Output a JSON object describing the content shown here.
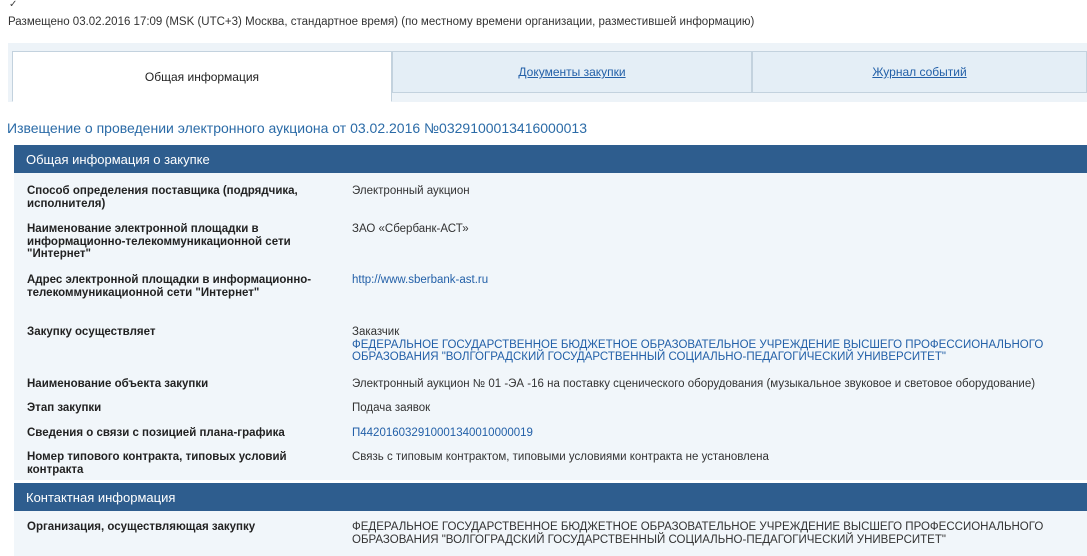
{
  "top_mark": "✓",
  "posted_line": "Размещено 03.02.2016 17:09 (MSK (UTC+3) Москва, стандартное время) (по местному времени организации, разместившей информацию)",
  "tabs": [
    {
      "label": "Общая информация",
      "active": true
    },
    {
      "label": "Документы закупки",
      "active": false
    },
    {
      "label": "Журнал событий",
      "active": false
    }
  ],
  "notice_title": "Извещение о проведении электронного аукциона от 03.02.2016 №0329100013416000013",
  "general": {
    "heading": "Общая информация о закупке",
    "rows": [
      {
        "label": "Способ определения поставщика (подрядчика, исполнителя)",
        "value": "Электронный аукцион"
      },
      {
        "label": "Наименование электронной площадки в информационно-телекоммуникационной сети \"Интернет\"",
        "value": "ЗАО «Сбербанк-АСТ»"
      },
      {
        "label": "Адрес электронной площадки в информационно-телекоммуникационной сети \"Интернет\"",
        "value": "http://www.sberbank-ast.ru"
      },
      {
        "label": "Закупку осуществляет",
        "value_role": "Заказчик",
        "value": "ФЕДЕРАЛЬНОЕ ГОСУДАРСТВЕННОЕ БЮДЖЕТНОЕ ОБРАЗОВАТЕЛЬНОЕ УЧРЕЖДЕНИЕ ВЫСШЕГО ПРОФЕССИОНАЛЬНОГО ОБРАЗОВАНИЯ \"ВОЛГОГРАДСКИЙ ГОСУДАРСТВЕННЫЙ СОЦИАЛЬНО-ПЕДАГОГИЧЕСКИЙ УНИВЕРСИТЕТ\""
      },
      {
        "label": "Наименование объекта закупки",
        "value": "Электронный аукцион № 01 -ЭА -16 на поставку сценического оборудования (музыкальное звуковое и световое оборудование)"
      },
      {
        "label": "Этап закупки",
        "value": "Подача заявок"
      },
      {
        "label": "Сведения о связи с позицией плана-графика",
        "value": "П442016032910001340010000019"
      },
      {
        "label": "Номер типового контракта, типовых условий контракта",
        "value": "Связь с типовым контрактом, типовыми условиями контракта не установлена"
      }
    ]
  },
  "contact": {
    "heading": "Контактная информация",
    "rows": [
      {
        "label": "Организация, осуществляющая закупку",
        "value": "ФЕДЕРАЛЬНОЕ ГОСУДАРСТВЕННОЕ БЮДЖЕТНОЕ ОБРАЗОВАТЕЛЬНОЕ УЧРЕЖДЕНИЕ ВЫСШЕГО ПРОФЕССИОНАЛЬНОГО ОБРАЗОВАНИЯ \"ВОЛГОГРАДСКИЙ ГОСУДАРСТВЕННЫЙ СОЦИАЛЬНО-ПЕДАГОГИЧЕСКИЙ УНИВЕРСИТЕТ\""
      }
    ]
  }
}
